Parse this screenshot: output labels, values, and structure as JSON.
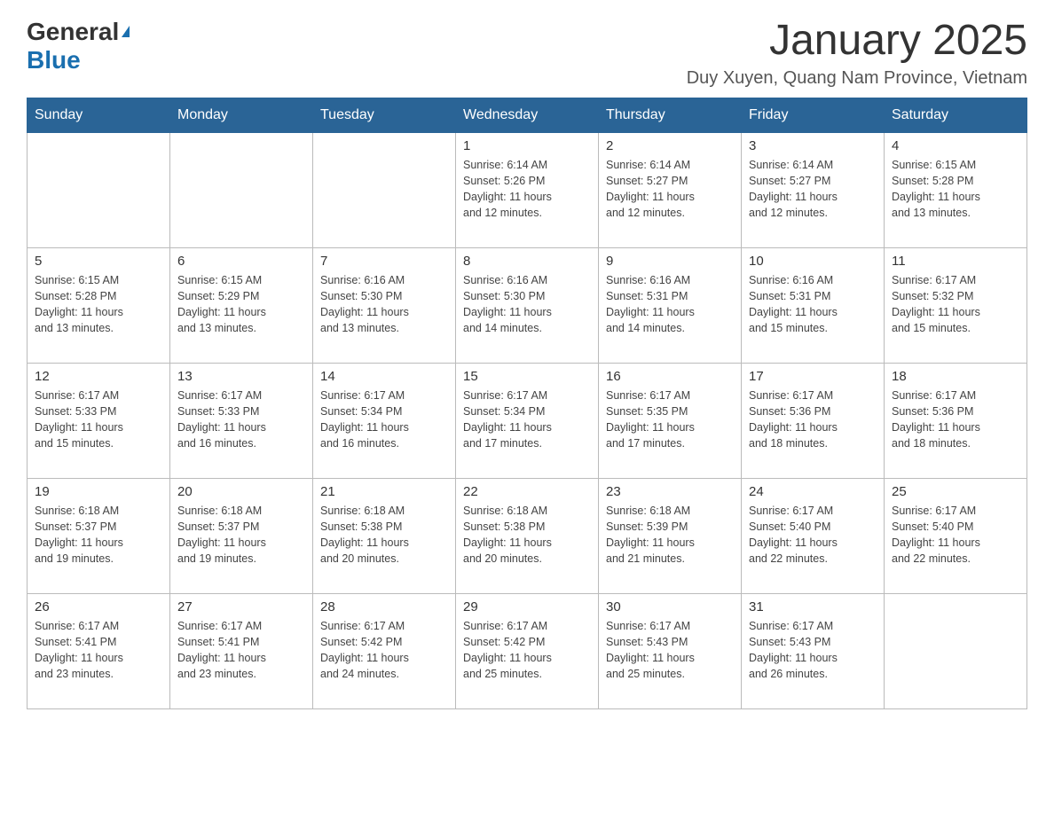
{
  "header": {
    "logo_general": "General",
    "logo_arrow": "▶",
    "logo_blue": "Blue",
    "main_title": "January 2025",
    "subtitle": "Duy Xuyen, Quang Nam Province, Vietnam"
  },
  "days_of_week": [
    "Sunday",
    "Monday",
    "Tuesday",
    "Wednesday",
    "Thursday",
    "Friday",
    "Saturday"
  ],
  "weeks": [
    [
      {
        "day": "",
        "info": ""
      },
      {
        "day": "",
        "info": ""
      },
      {
        "day": "",
        "info": ""
      },
      {
        "day": "1",
        "info": "Sunrise: 6:14 AM\nSunset: 5:26 PM\nDaylight: 11 hours\nand 12 minutes."
      },
      {
        "day": "2",
        "info": "Sunrise: 6:14 AM\nSunset: 5:27 PM\nDaylight: 11 hours\nand 12 minutes."
      },
      {
        "day": "3",
        "info": "Sunrise: 6:14 AM\nSunset: 5:27 PM\nDaylight: 11 hours\nand 12 minutes."
      },
      {
        "day": "4",
        "info": "Sunrise: 6:15 AM\nSunset: 5:28 PM\nDaylight: 11 hours\nand 13 minutes."
      }
    ],
    [
      {
        "day": "5",
        "info": "Sunrise: 6:15 AM\nSunset: 5:28 PM\nDaylight: 11 hours\nand 13 minutes."
      },
      {
        "day": "6",
        "info": "Sunrise: 6:15 AM\nSunset: 5:29 PM\nDaylight: 11 hours\nand 13 minutes."
      },
      {
        "day": "7",
        "info": "Sunrise: 6:16 AM\nSunset: 5:30 PM\nDaylight: 11 hours\nand 13 minutes."
      },
      {
        "day": "8",
        "info": "Sunrise: 6:16 AM\nSunset: 5:30 PM\nDaylight: 11 hours\nand 14 minutes."
      },
      {
        "day": "9",
        "info": "Sunrise: 6:16 AM\nSunset: 5:31 PM\nDaylight: 11 hours\nand 14 minutes."
      },
      {
        "day": "10",
        "info": "Sunrise: 6:16 AM\nSunset: 5:31 PM\nDaylight: 11 hours\nand 15 minutes."
      },
      {
        "day": "11",
        "info": "Sunrise: 6:17 AM\nSunset: 5:32 PM\nDaylight: 11 hours\nand 15 minutes."
      }
    ],
    [
      {
        "day": "12",
        "info": "Sunrise: 6:17 AM\nSunset: 5:33 PM\nDaylight: 11 hours\nand 15 minutes."
      },
      {
        "day": "13",
        "info": "Sunrise: 6:17 AM\nSunset: 5:33 PM\nDaylight: 11 hours\nand 16 minutes."
      },
      {
        "day": "14",
        "info": "Sunrise: 6:17 AM\nSunset: 5:34 PM\nDaylight: 11 hours\nand 16 minutes."
      },
      {
        "day": "15",
        "info": "Sunrise: 6:17 AM\nSunset: 5:34 PM\nDaylight: 11 hours\nand 17 minutes."
      },
      {
        "day": "16",
        "info": "Sunrise: 6:17 AM\nSunset: 5:35 PM\nDaylight: 11 hours\nand 17 minutes."
      },
      {
        "day": "17",
        "info": "Sunrise: 6:17 AM\nSunset: 5:36 PM\nDaylight: 11 hours\nand 18 minutes."
      },
      {
        "day": "18",
        "info": "Sunrise: 6:17 AM\nSunset: 5:36 PM\nDaylight: 11 hours\nand 18 minutes."
      }
    ],
    [
      {
        "day": "19",
        "info": "Sunrise: 6:18 AM\nSunset: 5:37 PM\nDaylight: 11 hours\nand 19 minutes."
      },
      {
        "day": "20",
        "info": "Sunrise: 6:18 AM\nSunset: 5:37 PM\nDaylight: 11 hours\nand 19 minutes."
      },
      {
        "day": "21",
        "info": "Sunrise: 6:18 AM\nSunset: 5:38 PM\nDaylight: 11 hours\nand 20 minutes."
      },
      {
        "day": "22",
        "info": "Sunrise: 6:18 AM\nSunset: 5:38 PM\nDaylight: 11 hours\nand 20 minutes."
      },
      {
        "day": "23",
        "info": "Sunrise: 6:18 AM\nSunset: 5:39 PM\nDaylight: 11 hours\nand 21 minutes."
      },
      {
        "day": "24",
        "info": "Sunrise: 6:17 AM\nSunset: 5:40 PM\nDaylight: 11 hours\nand 22 minutes."
      },
      {
        "day": "25",
        "info": "Sunrise: 6:17 AM\nSunset: 5:40 PM\nDaylight: 11 hours\nand 22 minutes."
      }
    ],
    [
      {
        "day": "26",
        "info": "Sunrise: 6:17 AM\nSunset: 5:41 PM\nDaylight: 11 hours\nand 23 minutes."
      },
      {
        "day": "27",
        "info": "Sunrise: 6:17 AM\nSunset: 5:41 PM\nDaylight: 11 hours\nand 23 minutes."
      },
      {
        "day": "28",
        "info": "Sunrise: 6:17 AM\nSunset: 5:42 PM\nDaylight: 11 hours\nand 24 minutes."
      },
      {
        "day": "29",
        "info": "Sunrise: 6:17 AM\nSunset: 5:42 PM\nDaylight: 11 hours\nand 25 minutes."
      },
      {
        "day": "30",
        "info": "Sunrise: 6:17 AM\nSunset: 5:43 PM\nDaylight: 11 hours\nand 25 minutes."
      },
      {
        "day": "31",
        "info": "Sunrise: 6:17 AM\nSunset: 5:43 PM\nDaylight: 11 hours\nand 26 minutes."
      },
      {
        "day": "",
        "info": ""
      }
    ]
  ]
}
